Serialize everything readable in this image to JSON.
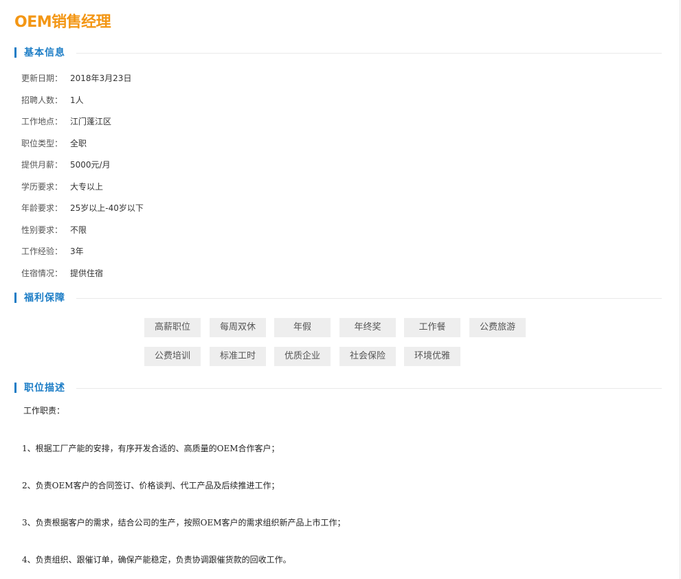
{
  "job_title": "OEM销售经理",
  "sections": {
    "basic": "基本信息",
    "benefits": "福利保障",
    "description": "职位描述"
  },
  "info": [
    {
      "key": "更新日期：",
      "value": "2018年3月23日"
    },
    {
      "key": "招聘人数：",
      "value": "1人"
    },
    {
      "key": "工作地点：",
      "value": "江门蓬江区"
    },
    {
      "key": "职位类型：",
      "value": "全职"
    },
    {
      "key": "提供月薪：",
      "value": "5000元/月"
    },
    {
      "key": "学历要求：",
      "value": "大专以上"
    },
    {
      "key": "年龄要求：",
      "value": "25岁以上-40岁以下"
    },
    {
      "key": "性别要求：",
      "value": "不限"
    },
    {
      "key": "工作经验：",
      "value": "3年"
    },
    {
      "key": "住宿情况：",
      "value": "提供住宿"
    }
  ],
  "benefits": [
    "高薪职位",
    "每周双休",
    "年假",
    "年终奖",
    "工作餐",
    "公费旅游",
    "公费培训",
    "标准工时",
    "优质企业",
    "社会保险",
    "环境优雅"
  ],
  "description": {
    "heading": "工作职责：",
    "items": [
      "1、根据工厂产能的安排，有序开发合适的、高质量的OEM合作客户；",
      "2、负责OEM客户的合同签订、价格谈判、代工产品及后续推进工作；",
      "3、负责根据客户的需求，结合公司的生产，按照OEM客户的需求组织新产品上市工作；",
      "4、负责组织、跟催订单，确保产能稳定，负责协调跟催货款的回收工作。"
    ]
  },
  "colors": {
    "title": "#f39614",
    "accent": "#1c7dc6",
    "tag_bg": "#eeeeee"
  }
}
